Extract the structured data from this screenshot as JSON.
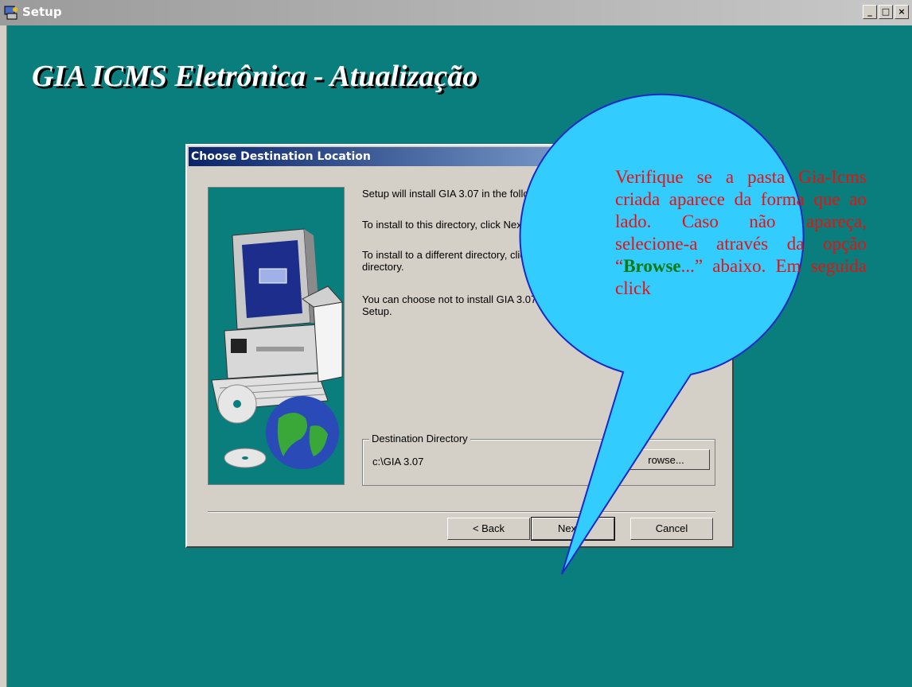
{
  "window": {
    "title": "Setup",
    "controls": [
      "_",
      "□",
      "×"
    ]
  },
  "heading": "GIA ICMS Eletrônica - Atualização",
  "dialog": {
    "title": "Choose Destination Location",
    "line1": "Setup will install GIA 3.07 in the following directo",
    "line2": "To install to this directory, click Next.",
    "line3a": "To install to a different directory, click Brows",
    "line3b": "directory.",
    "line4a": "You can choose not to install GIA 3.07 by c",
    "line4b": "Setup.",
    "group_label": "Destination Directory",
    "path": "c:\\GIA 3.07",
    "browse_label": "rowse...",
    "back_label": "< Back",
    "next_label": "Next >",
    "cancel_label": "Cancel"
  },
  "callout": {
    "text_before": "Verifique se a pasta Gia-Icms criada aparece da forma que ao lado. Caso não apareça, selecione-a através da opção “",
    "bold_word": "Browse",
    "text_after": "...” abaixo. Em seguida click",
    "fill_color": "#33ccff",
    "text_color": "#e8110f"
  },
  "colors": {
    "desktop": "#0a7d7d",
    "dialog_bg": "#d4d0c8",
    "title_active": "#0a246a"
  }
}
